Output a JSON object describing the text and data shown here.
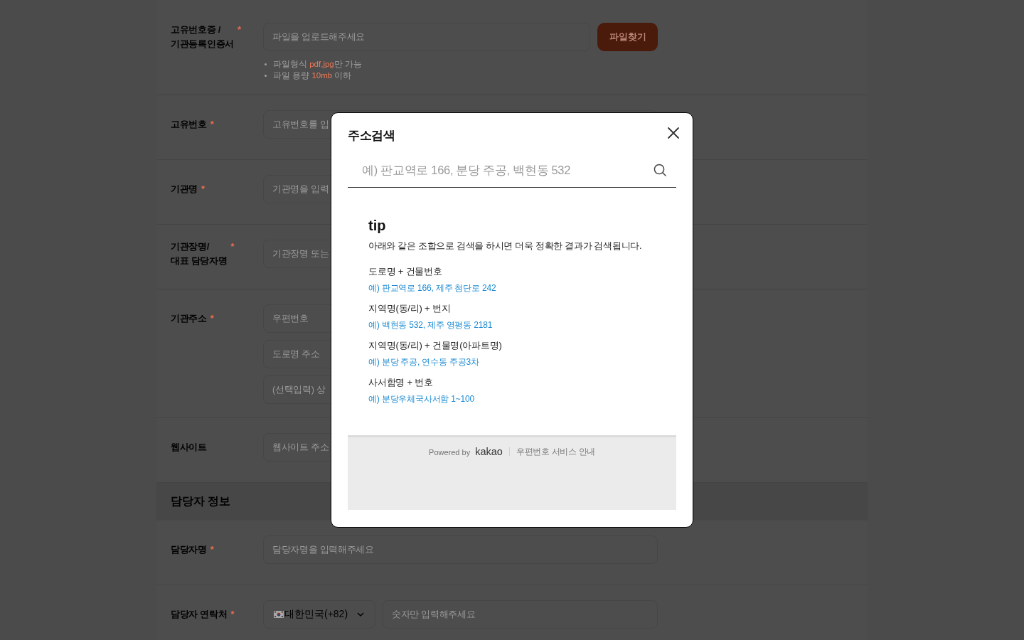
{
  "form": {
    "sections": [
      {
        "rows": [
          {
            "label": "고유번호증 /\n기관등록인증서",
            "required_mark": "*",
            "lines": [
              [
                {
                  "kind": "input",
                  "placeholder": "파일을 업로드해주세요"
                },
                {
                  "kind": "button",
                  "label": "파일찾기"
                }
              ]
            ],
            "notes": [
              {
                "before": "파일형식 ",
                "highlight": "pdf,jpg",
                "after": "만 가능"
              },
              {
                "before": "파일 용량 ",
                "highlight": "10mb",
                "after": " 이하"
              }
            ]
          },
          {
            "label": "고유번호",
            "required_mark": "*",
            "lines": [
              [
                {
                  "kind": "input",
                  "placeholder": "고유번호를 입"
                }
              ]
            ]
          },
          {
            "label": "기관명",
            "required_mark": "*",
            "lines": [
              [
                {
                  "kind": "input",
                  "placeholder": "기관명을 입력"
                }
              ]
            ]
          },
          {
            "label": "기관장명/\n대표 담당자명",
            "required_mark": "*",
            "lines": [
              [
                {
                  "kind": "input",
                  "placeholder": "기관장명 또는"
                }
              ]
            ]
          },
          {
            "label": "기관주소",
            "required_mark": "*",
            "lines": [
              [
                {
                  "kind": "input",
                  "placeholder": "우편번호"
                }
              ],
              [
                {
                  "kind": "input",
                  "placeholder": "도로명 주소"
                }
              ],
              [
                {
                  "kind": "input",
                  "placeholder": "(선택입력) 상"
                }
              ]
            ]
          },
          {
            "label": "웹사이트",
            "lines": [
              [
                {
                  "kind": "input",
                  "placeholder": "웹사이트 주소"
                }
              ]
            ]
          }
        ]
      },
      {
        "title": "담당자 정보",
        "rows": [
          {
            "label": "담당자명",
            "required_mark": "*",
            "lines": [
              [
                {
                  "kind": "input",
                  "placeholder": "담당자명을 입력해주세요"
                }
              ]
            ]
          },
          {
            "label": "담당자 연락처",
            "required_mark": "*",
            "lines": [
              [
                {
                  "kind": "select",
                  "value": "대한민국(+82)"
                },
                {
                  "kind": "input",
                  "placeholder": "숫자만 입력해주세요"
                }
              ]
            ]
          }
        ]
      }
    ]
  },
  "modal": {
    "title": "주소검색",
    "search": {
      "placeholder": "예) 판교역로 166, 분당 주공, 백현동 532"
    },
    "tip": {
      "heading": "tip",
      "description": "아래와 같은 조합으로 검색을 하시면 더욱 정확한 결과가 검색됩니다.",
      "examples": [
        {
          "pattern": "도로명 + 건물번호",
          "example": "예) 판교역로 166, 제주 첨단로 242"
        },
        {
          "pattern": "지역명(동/리) + 번지",
          "example": "예) 백현동 532, 제주 영평동 2181"
        },
        {
          "pattern": "지역명(동/리) + 건물명(아파트명)",
          "example": "예) 분당 주공, 연수동 주공3차"
        },
        {
          "pattern": "사서함명 + 번호",
          "example": "예) 분당우체국사서함 1~100"
        }
      ]
    },
    "footer": {
      "powered_by": "Powered by",
      "brand": "kakao",
      "link": "우편번호 서비스 안내"
    }
  }
}
